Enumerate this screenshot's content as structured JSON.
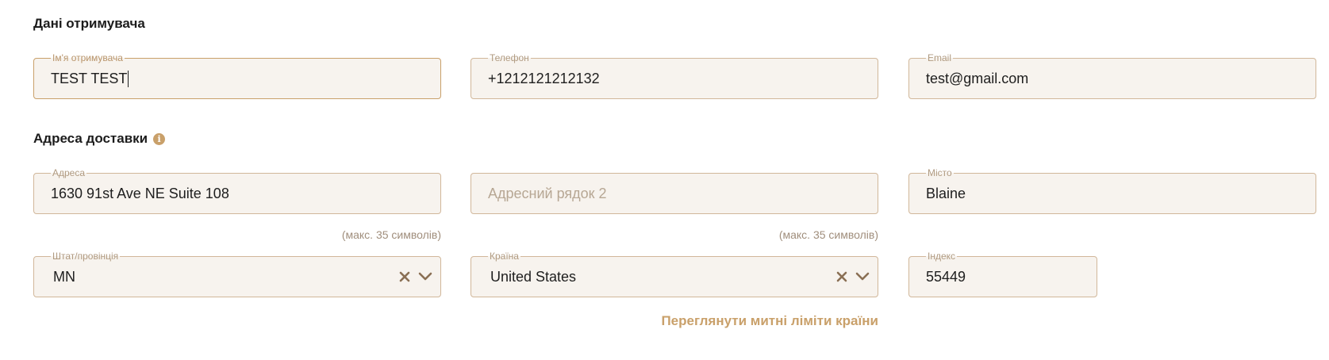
{
  "recipient": {
    "title": "Дані отримувача",
    "name": {
      "label": "Ім'я отримувача",
      "value": "TEST TEST"
    },
    "phone": {
      "label": "Телефон",
      "value": "+1212121212132"
    },
    "email": {
      "label": "Email",
      "value": "test@gmail.com"
    }
  },
  "delivery": {
    "title": "Адреса доставки",
    "info_icon": "info-circle-icon",
    "address": {
      "label": "Адреса",
      "value": "1630 91st Ave NE  Suite 108",
      "hint": "(макс. 35 символів)"
    },
    "address2": {
      "placeholder": "Адресний рядок 2",
      "hint": "(макс. 35 символів)"
    },
    "city": {
      "label": "Місто",
      "value": "Blaine"
    },
    "state": {
      "label": "Штат/провінція",
      "value": "MN"
    },
    "country": {
      "label": "Країна",
      "value": "United States"
    },
    "zip": {
      "label": "Індекс",
      "value": "55449"
    },
    "customs_link": "Переглянути митні ліміти країни"
  },
  "colors": {
    "accent": "#c9a06a",
    "field_bg": "#f7f3ee",
    "field_border": "#d1b79a",
    "select_icon": "#8a6f54"
  }
}
